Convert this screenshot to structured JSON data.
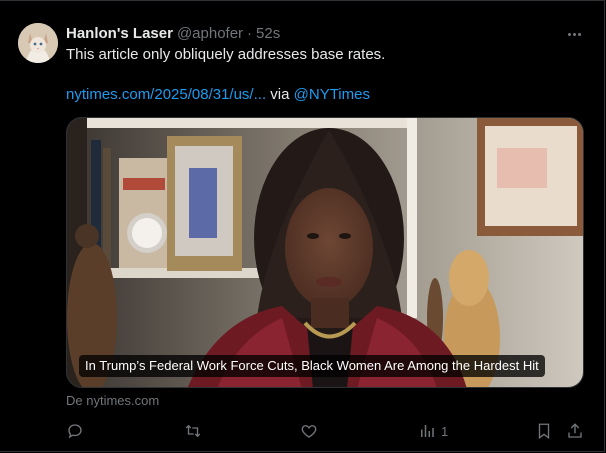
{
  "tweet": {
    "author_name": "Hanlon's Laser",
    "author_handle": "@aphofer",
    "separator": "·",
    "timestamp": "52s",
    "text": "This article only obliquely addresses base rates.",
    "link_text": "nytimes.com/2025/08/31/us/...",
    "via_text": "via",
    "via_handle": "@NYTimes"
  },
  "card": {
    "headline": "In Trump’s Federal Work Force Cuts, Black Women Are Among the Hardest Hit",
    "source": "De nytimes.com"
  },
  "actions": {
    "reply_icon": "reply-icon",
    "retweet_icon": "retweet-icon",
    "like_icon": "heart-icon",
    "views_icon": "views-icon",
    "views_count": "1",
    "bookmark_icon": "bookmark-icon",
    "share_icon": "share-icon"
  },
  "colors": {
    "background": "#000000",
    "text": "#e7e9ea",
    "secondary": "#71767b",
    "link": "#1d9bf0"
  }
}
